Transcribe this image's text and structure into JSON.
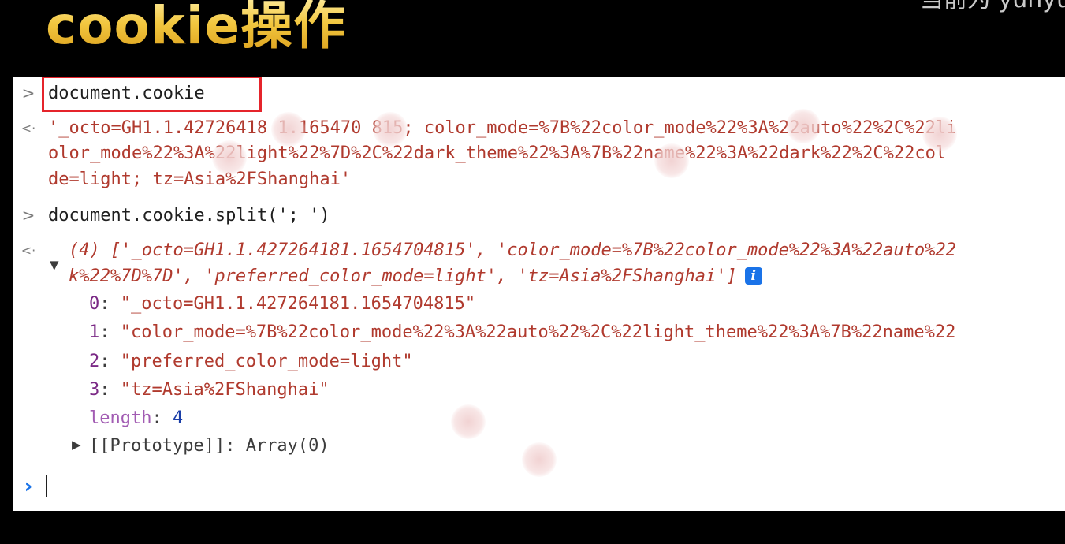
{
  "overlay": {
    "title": "cookie操作",
    "watermark": "当前为 yunyu"
  },
  "console": {
    "entries": [
      {
        "input": "document.cookie",
        "output_lines": [
          "'_octo=GH1.1.42726418 1.165470 815; color_mode=%7B%22color_mode%22%3A%22auto%22%2C%22li",
          "olor_mode%22%3A%22light%22%7D%2C%22dark_theme%22%3A%7B%22name%22%3A%22dark%22%2C%22col",
          "de=light; tz=Asia%2FShanghai'"
        ]
      },
      {
        "input": "document.cookie.split('; ')",
        "array_summary_line1": "(4) ['_octo=GH1.1.427264181.1654704815', 'color_mode=%7B%22color_mode%22%3A%22auto%22",
        "array_summary_line2": "k%22%7D%7D', 'preferred_color_mode=light', 'tz=Asia%2FShanghai']",
        "info_icon": "i",
        "items": [
          {
            "index": "0",
            "value": "\"_octo=GH1.1.427264181.1654704815\""
          },
          {
            "index": "1",
            "value": "\"color_mode=%7B%22color_mode%22%3A%22auto%22%2C%22light_theme%22%3A%7B%22name%22"
          },
          {
            "index": "2",
            "value": "\"preferred_color_mode=light\""
          },
          {
            "index": "3",
            "value": "\"tz=Asia%2FShanghai\""
          }
        ],
        "length_key": "length",
        "length_value": "4",
        "prototype_label": "[[Prototype]]",
        "prototype_value": "Array(0)"
      }
    ],
    "prompt_symbol": "›",
    "input_marker": ">",
    "output_marker": "<·"
  },
  "colors": {
    "title_gold": "#f2c740",
    "highlight_box": "#e5242b",
    "string_red": "#b03a2e",
    "number_blue": "#1a3ea8",
    "key_purple": "#7b2a86",
    "prompt_blue": "#1a73e8"
  }
}
